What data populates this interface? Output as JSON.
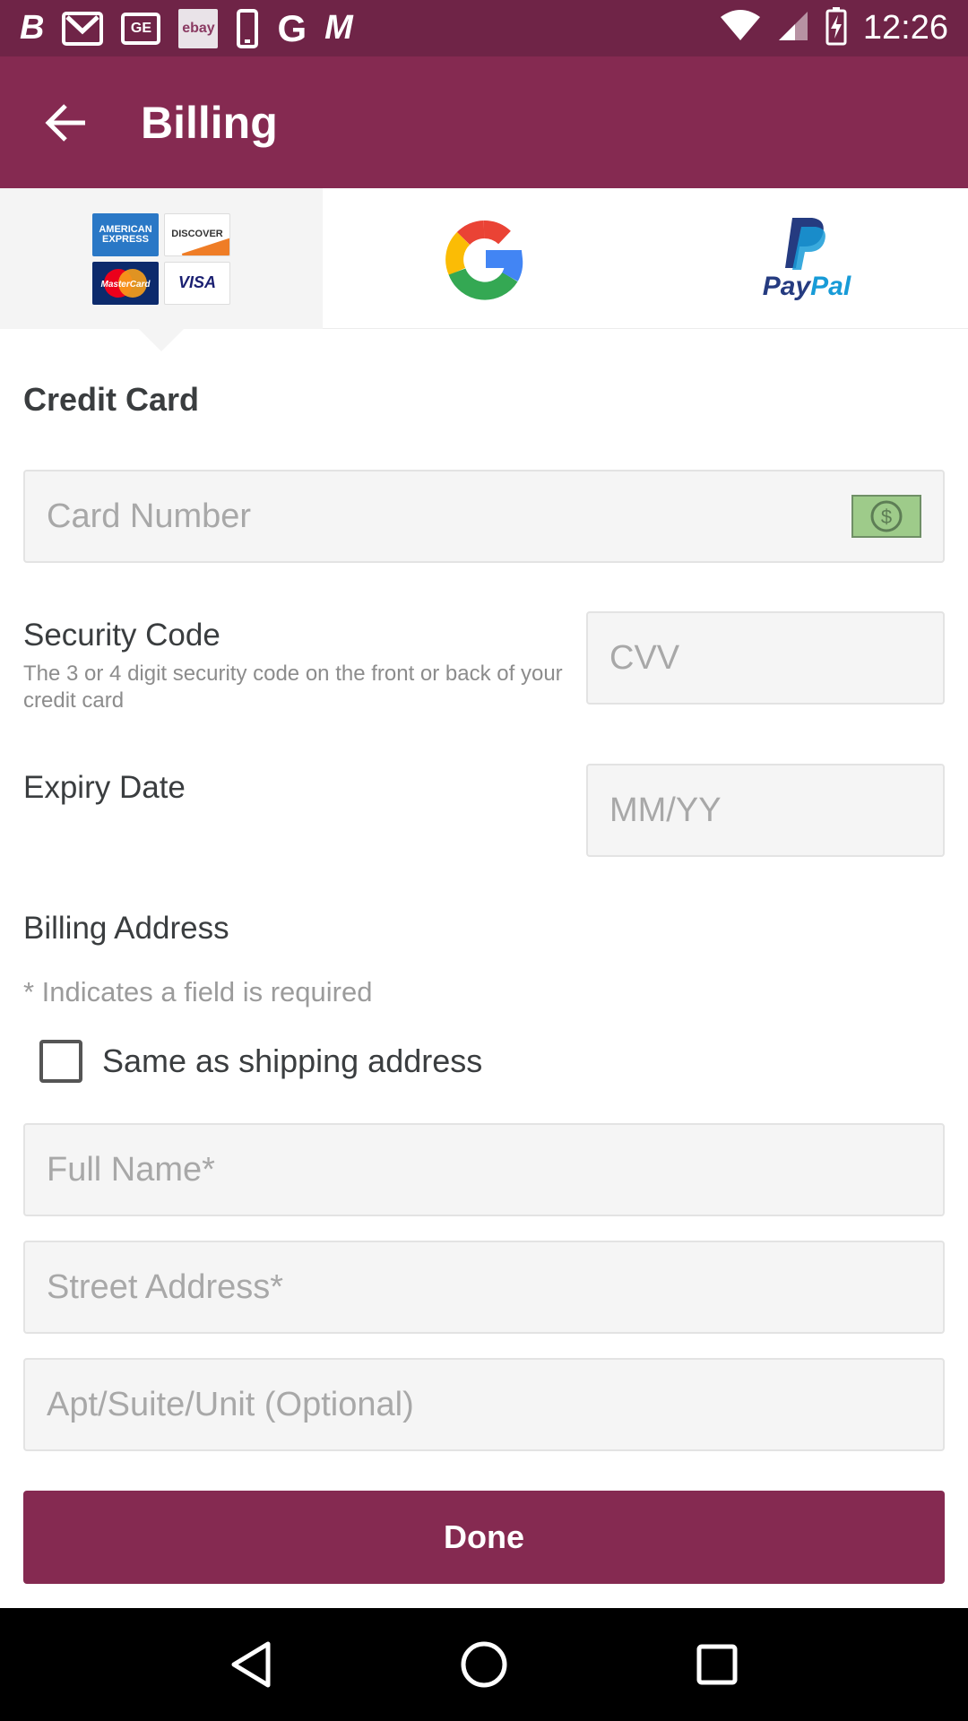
{
  "status_bar": {
    "time": "12:26",
    "left_icons": [
      "b-icon",
      "gmail-icon",
      "ge-icon",
      "ebay-icon",
      "phone-icon",
      "g-icon",
      "m-icon"
    ],
    "ge_label": "GE",
    "ebay_label": "ebay",
    "b_label": "B",
    "g_label": "G",
    "m_label": "M"
  },
  "app_bar": {
    "title": "Billing",
    "color": "#852a51"
  },
  "payment_tabs": {
    "cards": {
      "amex": "AMERICAN EXPRESS",
      "discover": "DISCOVER",
      "mastercard": "MasterCard",
      "visa": "VISA"
    },
    "google": "G",
    "paypal": {
      "pay": "Pay",
      "pal": "Pal"
    }
  },
  "form": {
    "section_title": "Credit Card",
    "card_number_placeholder": "Card Number",
    "security_code_label": "Security Code",
    "security_code_help": "The 3 or 4 digit security code on the front or back of your credit card",
    "cvv_placeholder": "CVV",
    "expiry_label": "Expiry Date",
    "expiry_placeholder": "MM/YY",
    "billing_address_label": "Billing Address",
    "required_note": "* Indicates a field is required",
    "same_as_shipping": "Same as shipping address",
    "same_as_shipping_checked": false,
    "full_name_placeholder": "Full Name*",
    "street_placeholder": "Street Address*",
    "apt_placeholder": "Apt/Suite/Unit (Optional)",
    "done_label": "Done"
  }
}
